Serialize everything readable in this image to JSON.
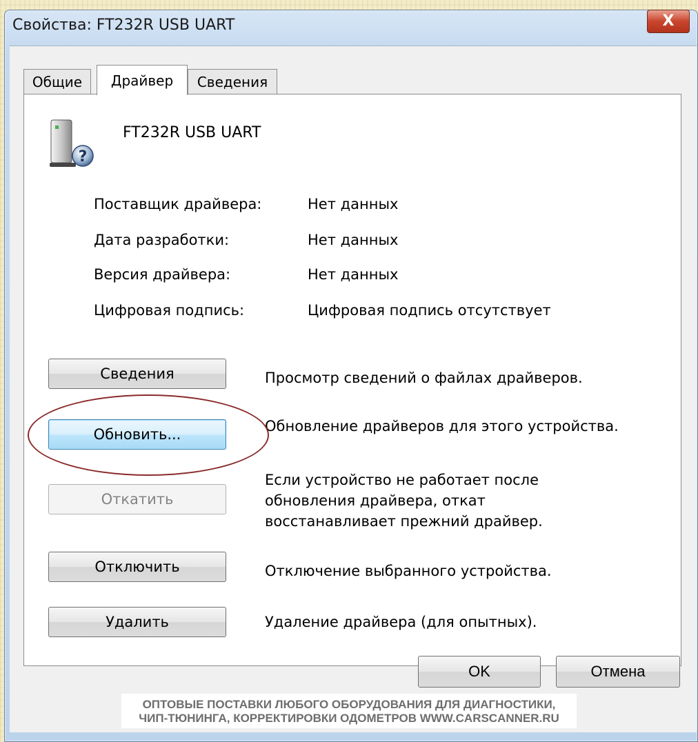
{
  "window": {
    "title": "Свойства: FT232R USB UART",
    "close_label": "X"
  },
  "tabs": [
    {
      "label": "Общие",
      "active": false
    },
    {
      "label": "Драйвер",
      "active": true
    },
    {
      "label": "Сведения",
      "active": false
    }
  ],
  "device": {
    "name": "FT232R USB UART",
    "icon": "usb-device-unknown-icon"
  },
  "properties": [
    {
      "label": "Поставщик драйвера:",
      "value": "Нет данных"
    },
    {
      "label": "Дата разработки:",
      "value": "Нет данных"
    },
    {
      "label": "Версия драйвера:",
      "value": "Нет данных"
    },
    {
      "label": "Цифровая подпись:",
      "value": "Цифровая подпись отсутствует"
    }
  ],
  "actions": [
    {
      "button": "Сведения",
      "description": [
        "Просмотр сведений о файлах драйверов."
      ],
      "enabled": true
    },
    {
      "button": "Обновить...",
      "description": [
        "Обновление драйверов для этого устройства."
      ],
      "enabled": true,
      "focused": true
    },
    {
      "button": "Откатить",
      "description": [
        "Если устройство не работает после",
        "обновления драйвера, откат",
        "восстанавливает прежний драйвер."
      ],
      "enabled": false
    },
    {
      "button": "Отключить",
      "description": [
        "Отключение выбранного устройства."
      ],
      "enabled": true
    },
    {
      "button": "Удалить",
      "description": [
        "Удаление драйвера (для опытных)."
      ],
      "enabled": true
    }
  ],
  "footer": {
    "ok_label": "OK",
    "cancel_label": "Отмена"
  },
  "watermark": {
    "line1": "ОПТОВЫЕ ПОСТАВКИ ЛЮБОГО ОБОРУДОВАНИЯ ДЛЯ ДИАГНОСТИКИ,",
    "line2": "ЧИП-ТЮНИНГА, КОРРЕКТИРОВКИ ОДОМЕТРОВ   WWW.CARSCANNER.RU"
  },
  "colors": {
    "highlight_ellipse": "#8b2a2a",
    "close_button": "#c9452d",
    "focus_blue": "#3c7fb1"
  }
}
